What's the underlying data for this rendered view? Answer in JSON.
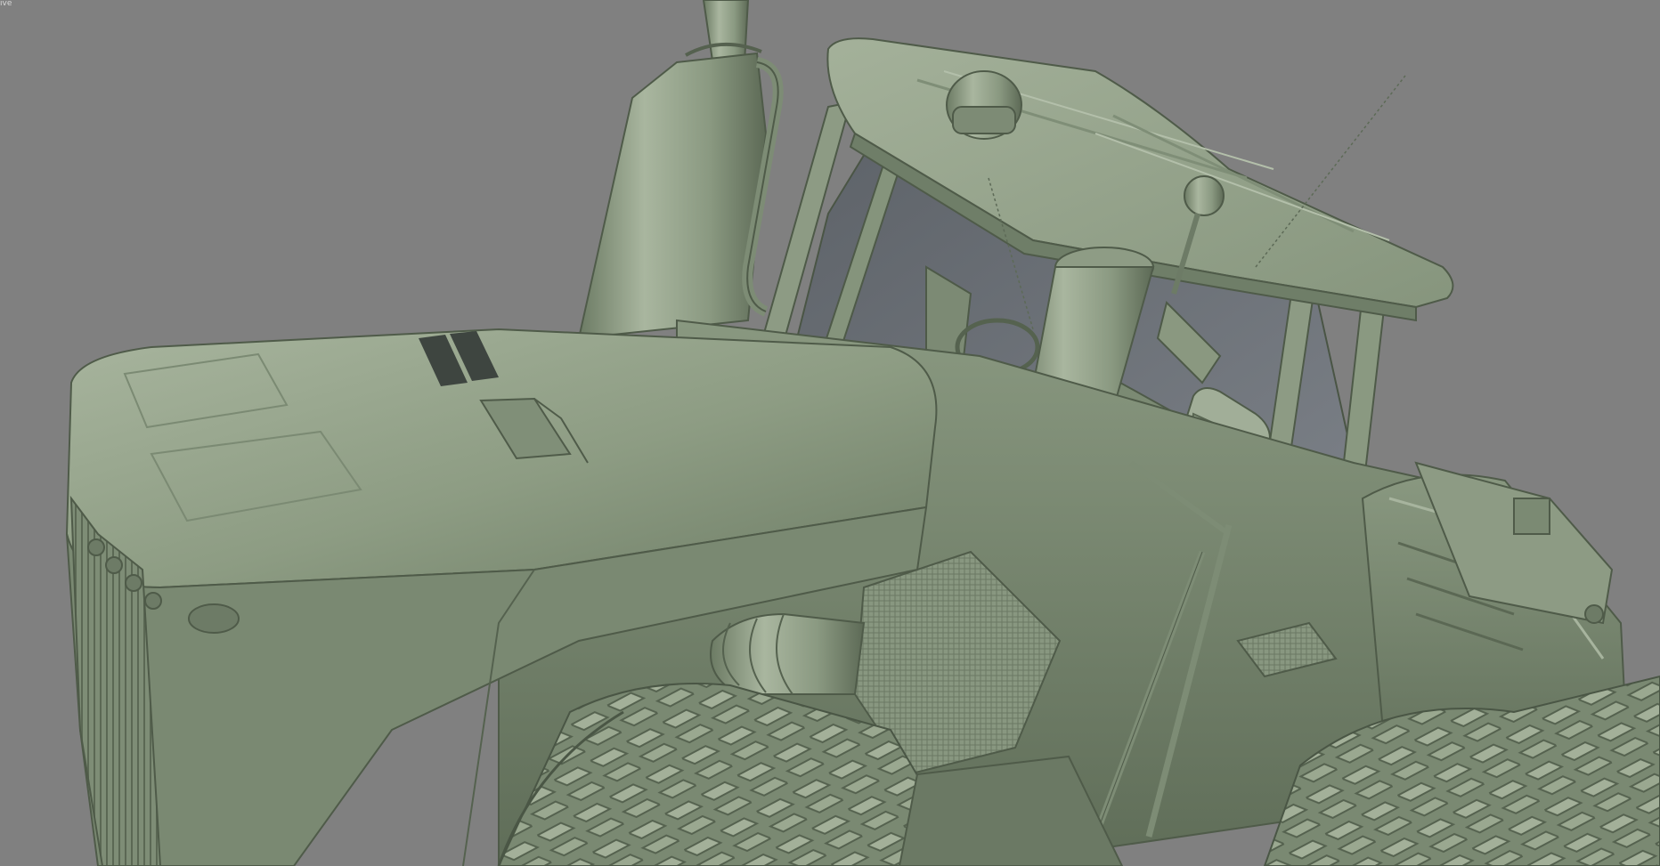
{
  "viewport": {
    "label": "ive",
    "shading_mode": "solid-clay",
    "background_color": "#808080",
    "model_color": "#8a9a80"
  },
  "model": {
    "subject": "tractor"
  }
}
